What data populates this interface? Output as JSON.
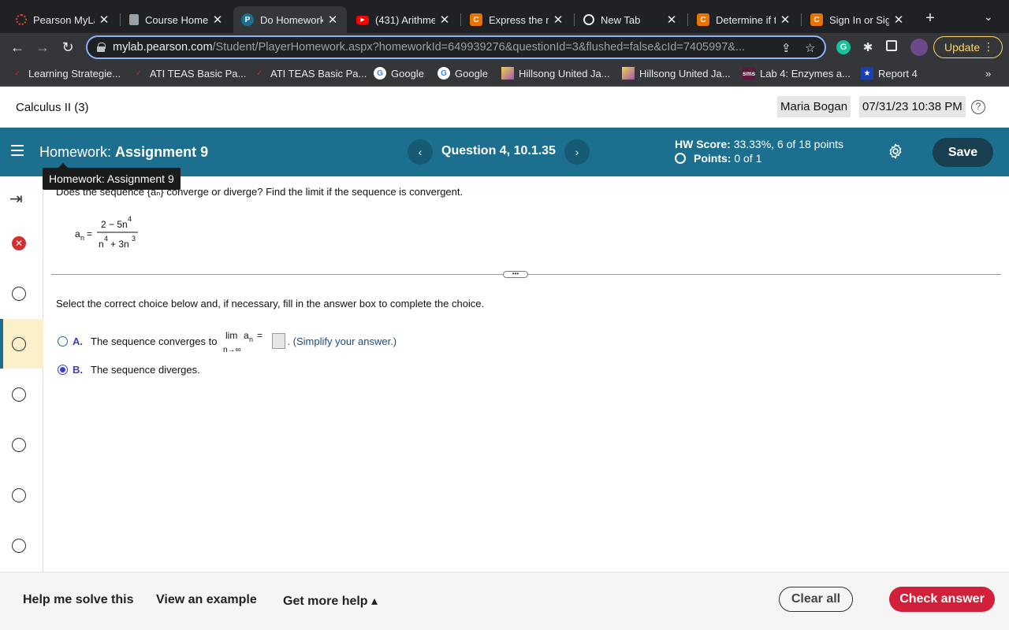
{
  "browser": {
    "tabs": [
      {
        "title": "Pearson MyLa",
        "favicon": "pearson-spinner-icon",
        "color": "#e0442b"
      },
      {
        "title": "Course Home",
        "favicon": "document-icon",
        "color": "#9aa0a6"
      },
      {
        "title": "Do Homework",
        "favicon": "pearson-p-icon",
        "color": "#1d6f8f",
        "active": true
      },
      {
        "title": "(431) Arithme",
        "favicon": "youtube-icon",
        "color": "#ff0000"
      },
      {
        "title": "Express the re",
        "favicon": "chegg-icon",
        "color": "#eb7100"
      },
      {
        "title": "New Tab",
        "favicon": "chrome-icon",
        "color": "#e8eaed"
      },
      {
        "title": "Determine if t",
        "favicon": "chegg-icon",
        "color": "#eb7100"
      },
      {
        "title": "Sign In or Sign",
        "favicon": "chegg-icon",
        "color": "#eb7100"
      }
    ],
    "url_host": "mylab.pearson.com",
    "url_path": "/Student/PlayerHomework.aspx?homeworkId=649939276&questionId=3&flushed=false&cId=7405997&...",
    "update_label": "Update",
    "bookmarks": [
      {
        "label": "Learning Strategie...",
        "icon": "ati-icon"
      },
      {
        "label": "ATI TEAS Basic Pa...",
        "icon": "ati-icon"
      },
      {
        "label": "ATI TEAS Basic Pa...",
        "icon": "ati-icon"
      },
      {
        "label": "Google",
        "icon": "google-icon"
      },
      {
        "label": "Google",
        "icon": "google-icon"
      },
      {
        "label": "Hillsong United Ja...",
        "icon": "hillsong-icon"
      },
      {
        "label": "Hillsong United Ja...",
        "icon": "hillsong-icon"
      },
      {
        "label": "Lab 4: Enzymes a...",
        "icon": "sms-icon"
      },
      {
        "label": "Report 4",
        "icon": "star-icon"
      }
    ],
    "bookmarks_more": "»"
  },
  "course": {
    "title": "Calculus II (3)",
    "user": "Maria Bogan",
    "datetime": "07/31/23 10:38 PM"
  },
  "homework": {
    "label_prefix": "Homework:",
    "assignment": "Assignment 9",
    "question_label": "Question 4, 10.1.35",
    "hw_score_label": "HW Score:",
    "hw_score_value": "33.33%, 6 of 18 points",
    "points_label": "Points:",
    "points_value": "0 of 1",
    "save_label": "Save",
    "tooltip": "Homework: Assignment 9"
  },
  "question": {
    "prompt": "Does the sequence {aₙ} converge or diverge? Find the limit if the sequence is convergent.",
    "instruction": "Select the correct choice below and, if necessary, fill in the answer box to complete the choice.",
    "choice_a_letter": "A.",
    "choice_a_text": "The sequence converges to",
    "choice_a_hint": ". (Simplify your answer.)",
    "choice_b_letter": "B.",
    "choice_b_text": "The sequence diverges.",
    "selected": "B"
  },
  "footer": {
    "help_solve": "Help me solve this",
    "view_example": "View an example",
    "more_help": "Get more help ▴",
    "clear_all": "Clear all",
    "check_answer": "Check answer"
  }
}
